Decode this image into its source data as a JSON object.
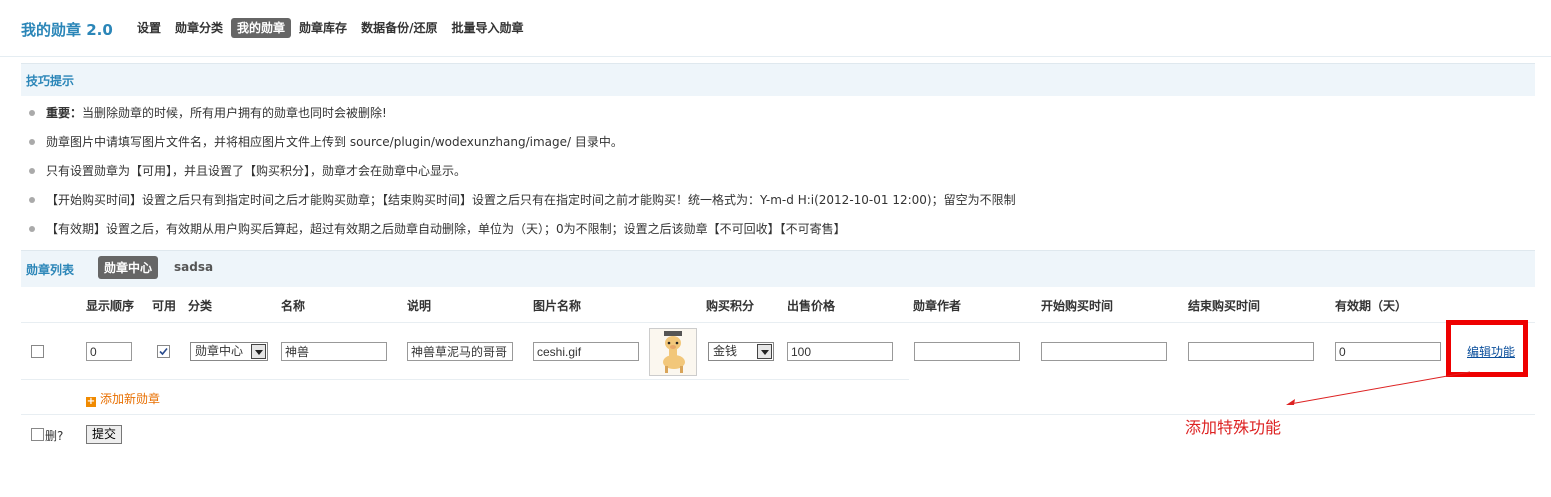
{
  "app": {
    "title": "我的勋章 2.0"
  },
  "nav": [
    {
      "label": "设置"
    },
    {
      "label": "勋章分类"
    },
    {
      "label": "我的勋章",
      "active": true
    },
    {
      "label": "勋章库存"
    },
    {
      "label": "数据备份/还原"
    },
    {
      "label": "批量导入勋章"
    }
  ],
  "tips": {
    "header": "技巧提示",
    "items": [
      {
        "strong": "重要：",
        "text": "当删除勋章的时候，所有用户拥有的勋章也同时会被删除!"
      },
      {
        "strong": "",
        "text": "勋章图片中请填写图片文件名，并将相应图片文件上传到 source/plugin/wodexunzhang/image/ 目录中。"
      },
      {
        "strong": "",
        "text": "只有设置勋章为【可用】，并且设置了【购买积分】，勋章才会在勋章中心显示。"
      },
      {
        "strong": "",
        "text": "【开始购买时间】设置之后只有到指定时间之后才能购买勋章；【结束购买时间】设置之后只有在指定时间之前才能购买！统一格式为：Y-m-d H:i(2012-10-01 12:00)；留空为不限制"
      },
      {
        "strong": "",
        "text": "【有效期】设置之后，有效期从用户购买后算起，超过有效期之后勋章自动删除，单位为（天）；0为不限制；设置之后该勋章【不可回收】【不可寄售】"
      }
    ]
  },
  "list": {
    "header": "勋章列表",
    "tabs": [
      {
        "label": "勋章中心",
        "active": true
      },
      {
        "label": "sadsa"
      }
    ]
  },
  "table": {
    "headers": {
      "order": "显示顺序",
      "enabled": "可用",
      "category": "分类",
      "name": "名称",
      "desc": "说明",
      "image": "图片名称",
      "credit": "购买积分",
      "price": "出售价格",
      "author": "勋章作者",
      "start": "开始购买时间",
      "end": "结束购买时间",
      "valid": "有效期（天）"
    },
    "row": {
      "order": "0",
      "enabled": true,
      "category": "勋章中心",
      "name": "神兽",
      "desc": "神兽草泥马的哥哥",
      "image": "ceshi.gif",
      "credit": "金钱",
      "price": "100",
      "author": "",
      "start": "",
      "end": "",
      "valid": "0",
      "edit": "编辑功能"
    }
  },
  "add_new": "添加新勋章",
  "delete_label": "删?",
  "submit": "提交",
  "annotation": "添加特殊功能",
  "colors": {
    "accent": "#2b86b8",
    "annotation": "#dd2222",
    "add": "#e86f00"
  }
}
